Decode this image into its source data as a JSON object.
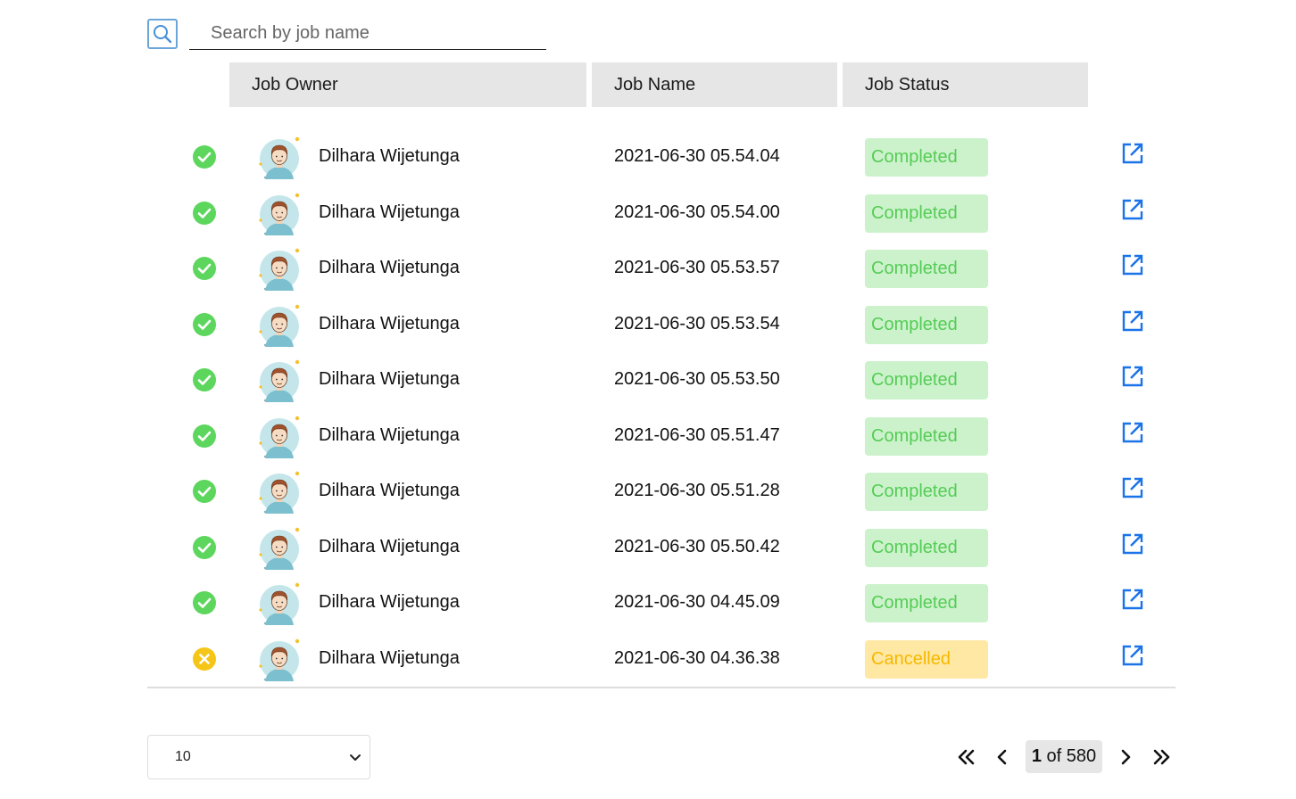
{
  "search": {
    "placeholder": "Search by job name",
    "value": ""
  },
  "table": {
    "headers": {
      "owner": "Job Owner",
      "name": "Job Name",
      "status": "Job Status"
    },
    "rows": [
      {
        "state": "success",
        "owner": "Dilhara Wijetunga",
        "job_name": "2021-06-30 05.54.04",
        "status": "Completed"
      },
      {
        "state": "success",
        "owner": "Dilhara Wijetunga",
        "job_name": "2021-06-30 05.54.00",
        "status": "Completed"
      },
      {
        "state": "success",
        "owner": "Dilhara Wijetunga",
        "job_name": "2021-06-30 05.53.57",
        "status": "Completed"
      },
      {
        "state": "success",
        "owner": "Dilhara Wijetunga",
        "job_name": "2021-06-30 05.53.54",
        "status": "Completed"
      },
      {
        "state": "success",
        "owner": "Dilhara Wijetunga",
        "job_name": "2021-06-30 05.53.50",
        "status": "Completed"
      },
      {
        "state": "success",
        "owner": "Dilhara Wijetunga",
        "job_name": "2021-06-30 05.51.47",
        "status": "Completed"
      },
      {
        "state": "success",
        "owner": "Dilhara Wijetunga",
        "job_name": "2021-06-30 05.51.28",
        "status": "Completed"
      },
      {
        "state": "success",
        "owner": "Dilhara Wijetunga",
        "job_name": "2021-06-30 05.50.42",
        "status": "Completed"
      },
      {
        "state": "success",
        "owner": "Dilhara Wijetunga",
        "job_name": "2021-06-30 04.45.09",
        "status": "Completed"
      },
      {
        "state": "cancelled",
        "owner": "Dilhara Wijetunga",
        "job_name": "2021-06-30 04.36.38",
        "status": "Cancelled"
      }
    ]
  },
  "pagination": {
    "page_size": "10",
    "current_page": "1",
    "of_label": "of",
    "total_pages": "580"
  },
  "colors": {
    "success": "#5cd65c",
    "cancelled": "#f5c518",
    "completed_badge_bg": "#ccf2cc",
    "cancelled_badge_bg": "#ffe8a3",
    "link_blue": "#1a73e8",
    "header_bg": "#e6e6e6"
  },
  "icons": {
    "search": "search-icon",
    "success": "check-circle-icon",
    "cancelled": "x-circle-icon",
    "edit": "open-external-icon",
    "first": "double-chevron-left-icon",
    "prev": "chevron-left-icon",
    "next": "chevron-right-icon",
    "last": "double-chevron-right-icon"
  }
}
